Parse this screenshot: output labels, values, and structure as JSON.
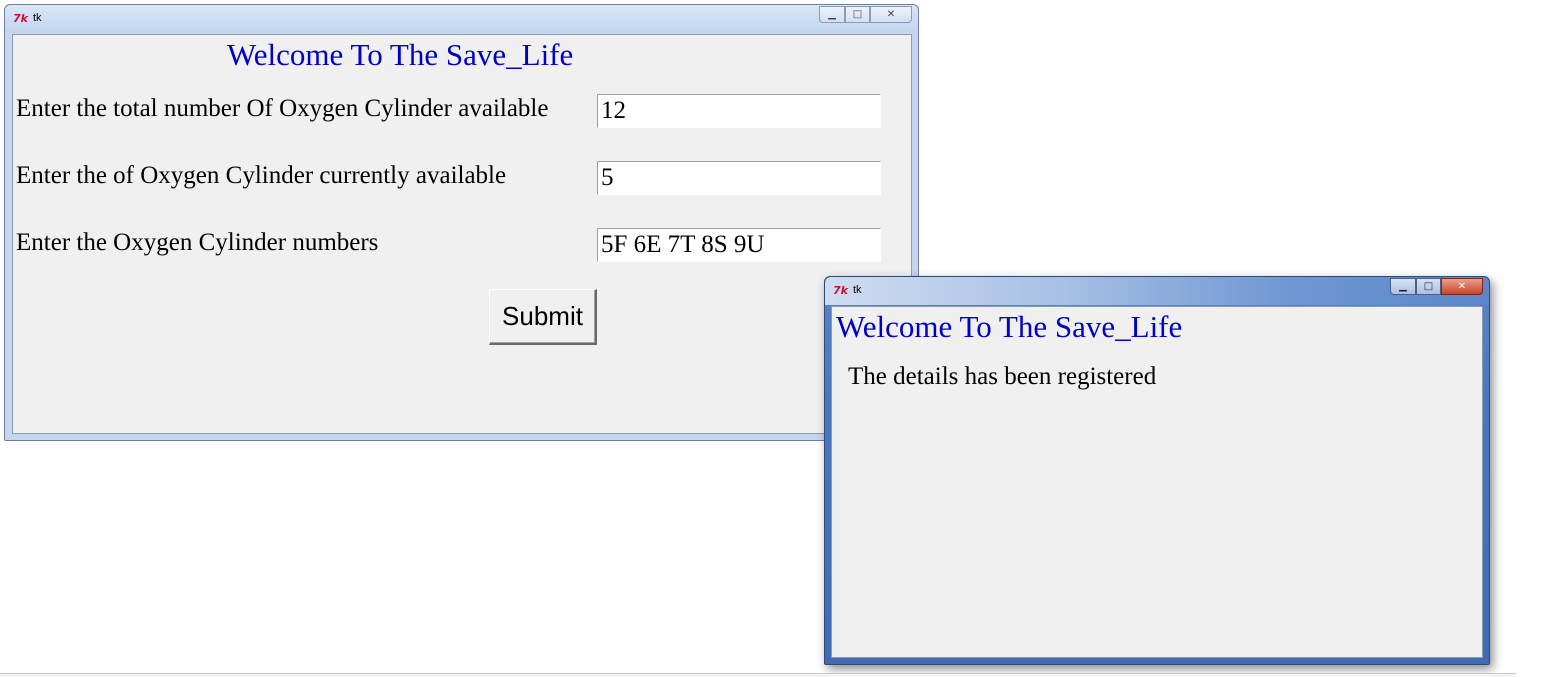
{
  "main_window": {
    "title": "tk",
    "icon": "tk-feather-icon",
    "heading": "Welcome To The Save_Life",
    "fields": [
      {
        "label": "Enter the total number Of Oxygen Cylinder available",
        "value": "12"
      },
      {
        "label": "Enter the of Oxygen Cylinder currently available",
        "value": "5"
      },
      {
        "label": "Enter the Oxygen Cylinder numbers",
        "value": "5F 6E 7T 8S 9U"
      }
    ],
    "submit_label": "Submit",
    "caption_buttons": {
      "minimize": "minimize-icon",
      "maximize": "maximize-icon",
      "close": "close-icon"
    }
  },
  "dialog_window": {
    "title": "tk",
    "icon": "tk-feather-icon",
    "heading": "Welcome To The Save_Life",
    "message": "The details has been registered"
  },
  "colors": {
    "heading": "#0000cc",
    "client_bg": "#f0f0f0"
  }
}
